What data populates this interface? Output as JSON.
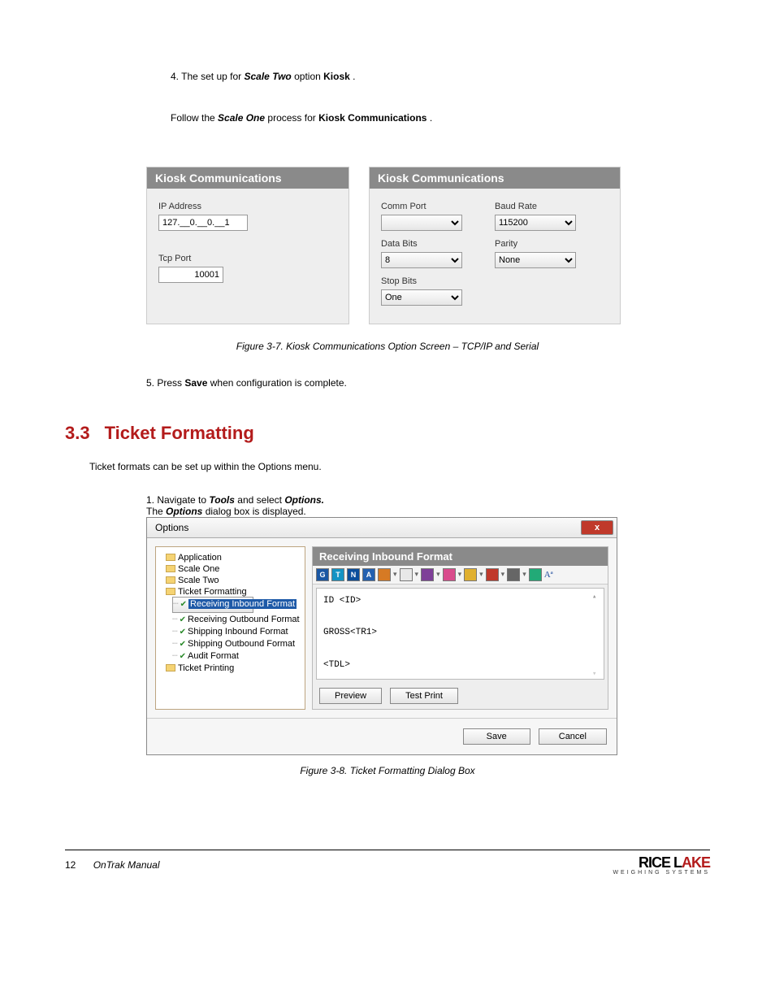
{
  "intro": {
    "line1_prefix": "4. The set up for ",
    "line1_scale": "Scale Two",
    "line1_middle": " option ",
    "line1_kiosk": "Kiosk",
    "line1_period": ".",
    "line2_prefix": "Follow the ",
    "line2_scale": "Scale One",
    "line2_middle": " process for ",
    "line2_kiosk": "Kiosk Communications",
    "line2_period": "."
  },
  "panelLeft": {
    "head": "Kiosk Communications",
    "ip_label": "IP Address",
    "ip_value": "127.__0.__0.__1",
    "tcp_label": "Tcp Port",
    "tcp_value": "10001"
  },
  "panelRight": {
    "head": "Kiosk Communications",
    "comm_label": "Comm Port",
    "comm_value": "",
    "baud_label": "Baud Rate",
    "baud_value": "115200",
    "data_label": "Data Bits",
    "data_value": "8",
    "parity_label": "Parity",
    "parity_value": "None",
    "stop_label": "Stop Bits",
    "stop_value": "One"
  },
  "fig1_caption": "Figure 3-7. Kiosk Communications Option Screen – TCP/IP and Serial",
  "save_line_prefix": "5. Press ",
  "save_word": "Save",
  "save_line_suffix": " when configuration is complete.",
  "section": {
    "num": "3.3",
    "title": "Ticket Formatting"
  },
  "tf_intro": "Ticket formats can be set up within the Options menu.",
  "tf_step1_a": "1. Navigate to ",
  "tf_step1_tools": "Tools",
  "tf_step1_b": " and select ",
  "tf_step1_options": "Options.",
  "tf_step2_prefix": "The ",
  "tf_step2_options": "Options",
  "tf_step2_suffix": " dialog box is displayed.",
  "dialog": {
    "title": "Options",
    "tree": {
      "app": "Application",
      "s1": "Scale One",
      "s2": "Scale Two",
      "tf": "Ticket Formatting",
      "rif": "Receiving Inbound Format",
      "rof": "Receiving Outbound Format",
      "sif": "Shipping Inbound Format",
      "sof": "Shipping Outbound Format",
      "af": "Audit Format",
      "tp": "Ticket Printing"
    },
    "right_head": "Receiving Inbound Format",
    "toolbar": {
      "g": "G",
      "t": "T",
      "n": "N",
      "a": "A",
      "aa": "Aª"
    },
    "editor": "ID <ID>\n\nGROSS<TR1>\n\n<TDL>",
    "preview": "Preview",
    "test": "Test Print",
    "save": "Save",
    "cancel": "Cancel"
  },
  "fig2_caption": "Figure 3-8. Ticket Formatting Dialog Box",
  "footer": {
    "page": "12",
    "manual": "OnTrak Manual",
    "logo1": "RICE L",
    "logo2": "AKE",
    "logosub": "WEIGHING SYSTEMS"
  }
}
